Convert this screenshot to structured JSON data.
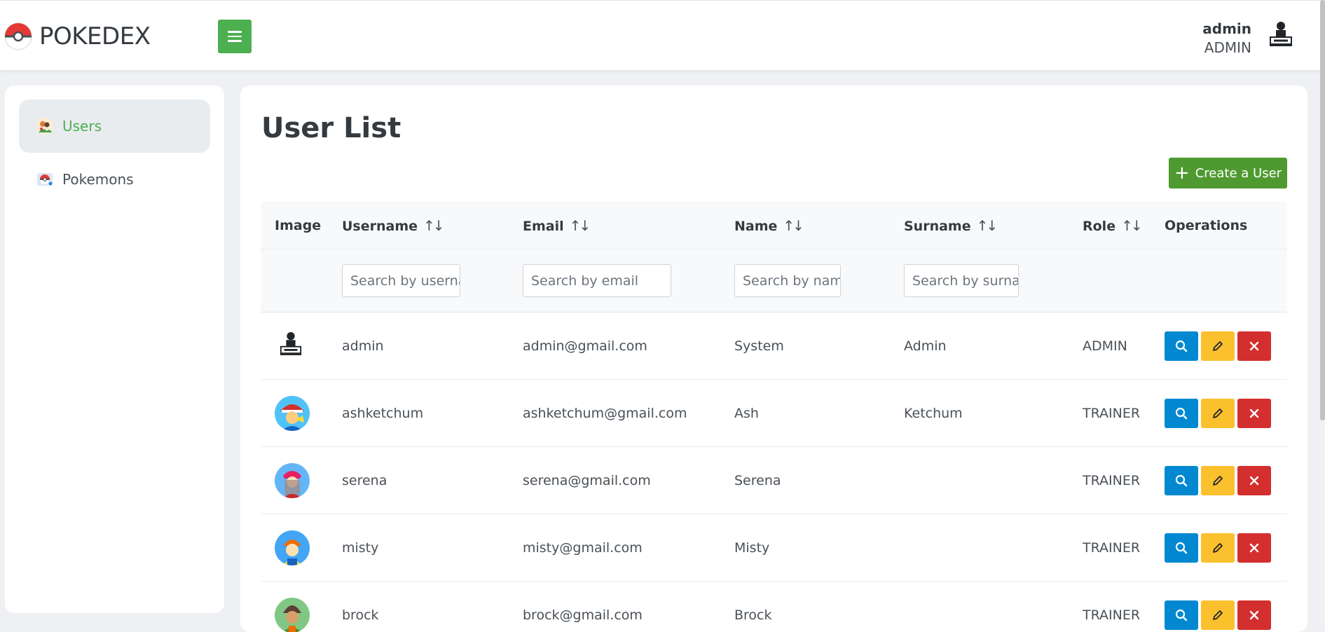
{
  "app": {
    "title": "POKEDEX"
  },
  "topbar": {
    "user_name": "admin",
    "user_role": "ADMIN",
    "accent": "#4caf50"
  },
  "sidebar": {
    "items": [
      {
        "label": "Users",
        "icon": "users-icon",
        "active": true
      },
      {
        "label": "Pokemons",
        "icon": "pokeball-icon",
        "active": false
      }
    ]
  },
  "main": {
    "title": "User List",
    "create_label": "Create a User",
    "columns": [
      {
        "label": "Image",
        "sortable": false
      },
      {
        "label": "Username",
        "sortable": true
      },
      {
        "label": "Email",
        "sortable": true
      },
      {
        "label": "Name",
        "sortable": true
      },
      {
        "label": "Surname",
        "sortable": true
      },
      {
        "label": "Role",
        "sortable": true
      },
      {
        "label": "Operations",
        "sortable": false
      }
    ],
    "filters": {
      "username_placeholder": "Search by username",
      "email_placeholder": "Search by email",
      "name_placeholder": "Search by name",
      "surname_placeholder": "Search by surname"
    },
    "sort_icon": "↑↓",
    "rows": [
      {
        "username": "admin",
        "email": "admin@gmail.com",
        "name": "System",
        "surname": "Admin",
        "role": "ADMIN",
        "avatar": "admin-stamp-icon"
      },
      {
        "username": "ashketchum",
        "email": "ashketchum@gmail.com",
        "name": "Ash",
        "surname": "Ketchum",
        "role": "TRAINER",
        "avatar": "ash-avatar"
      },
      {
        "username": "serena",
        "email": "serena@gmail.com",
        "name": "Serena",
        "surname": "",
        "role": "TRAINER",
        "avatar": "serena-avatar"
      },
      {
        "username": "misty",
        "email": "misty@gmail.com",
        "name": "Misty",
        "surname": "",
        "role": "TRAINER",
        "avatar": "misty-avatar"
      },
      {
        "username": "brock",
        "email": "brock@gmail.com",
        "name": "Brock",
        "surname": "",
        "role": "TRAINER",
        "avatar": "brock-avatar"
      }
    ]
  },
  "colors": {
    "view": "#0288d1",
    "edit": "#fbc02d",
    "delete": "#d32f2f",
    "create": "#4e9a31"
  }
}
